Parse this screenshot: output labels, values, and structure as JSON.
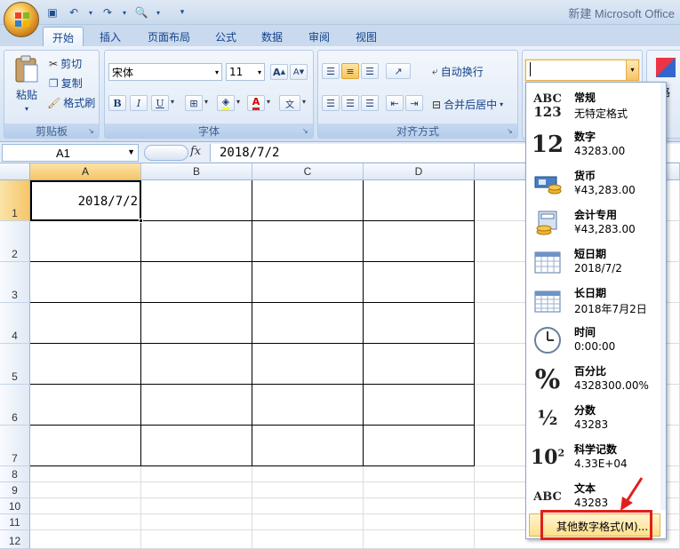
{
  "app": {
    "title": "新建 Microsoft Office"
  },
  "tabs": [
    "开始",
    "插入",
    "页面布局",
    "公式",
    "数据",
    "审阅",
    "视图"
  ],
  "ribbon": {
    "clipboard": {
      "paste": "粘贴",
      "cut": "剪切",
      "copy": "复制",
      "format_painter": "格式刷",
      "label": "剪贴板"
    },
    "font": {
      "font_name": "宋体",
      "font_size": "11",
      "bold": "B",
      "italic": "I",
      "underline": "U",
      "label": "字体",
      "grow": "A",
      "shrink": "A"
    },
    "alignment": {
      "wrap": "自动换行",
      "merge": "合并后居中",
      "label": "对齐方式"
    },
    "number_format_value": "",
    "right_edge": "格"
  },
  "formula_bar": {
    "name_box": "A1",
    "fx": "fx",
    "value": "2018/7/2"
  },
  "sheet": {
    "columns": [
      "A",
      "B",
      "C",
      "D"
    ],
    "rows": [
      "1",
      "2",
      "3",
      "4",
      "5",
      "6",
      "7",
      "8",
      "9",
      "10",
      "11",
      "12"
    ],
    "a1_value": "2018/7/2"
  },
  "number_formats": [
    {
      "icon": "abc123-icon",
      "name": "常规",
      "value": "无特定格式"
    },
    {
      "icon": "number-12-icon",
      "name": "数字",
      "value": "43283.00"
    },
    {
      "icon": "currency-icon",
      "name": "货币",
      "value": "¥43,283.00"
    },
    {
      "icon": "accounting-icon",
      "name": "会计专用",
      "value": " ¥43,283.00"
    },
    {
      "icon": "calendar-short-icon",
      "name": "短日期",
      "value": "2018/7/2"
    },
    {
      "icon": "calendar-long-icon",
      "name": "长日期",
      "value": "2018年7月2日"
    },
    {
      "icon": "clock-icon",
      "name": "时间",
      "value": "0:00:00"
    },
    {
      "icon": "percent-icon",
      "name": "百分比",
      "value": "4328300.00%"
    },
    {
      "icon": "fraction-icon",
      "name": "分数",
      "value": "43283"
    },
    {
      "icon": "scientific-icon",
      "name": "科学记数",
      "value": "4.33E+04"
    },
    {
      "icon": "text-abc-icon",
      "name": "文本",
      "value": "43283"
    }
  ],
  "more_formats": "其他数字格式(M)...",
  "colors": {
    "accent_red": "#e0201a",
    "highlight": "#f9c25c"
  }
}
